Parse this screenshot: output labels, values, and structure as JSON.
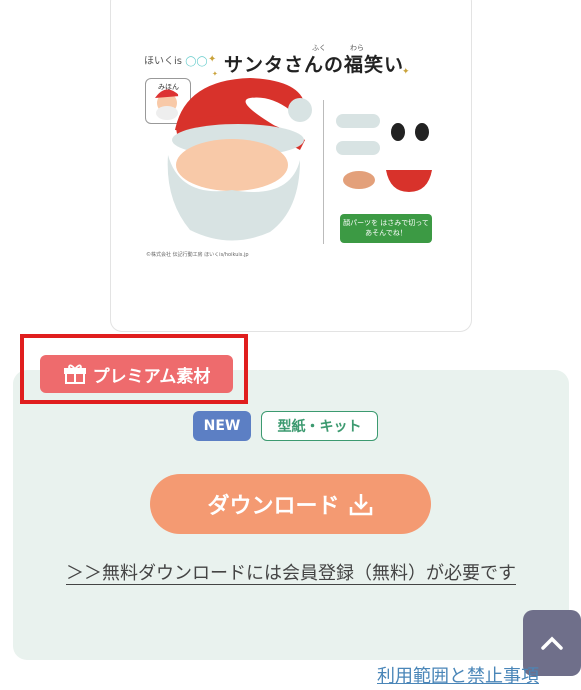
{
  "preview": {
    "brand": "ほいくis",
    "title": "サンタさんの福笑い",
    "ruby_fuku": "ふく",
    "ruby_warai": "わら",
    "sample_label": "みほん",
    "hint_text": "顔パーツを はさみで切って あそんでね！",
    "copyright": "©株式会社 伝記行動工房 ほいくis/hoikuis.jp"
  },
  "premium_badge": {
    "label": "プレミアム素材",
    "icon": "gift-icon"
  },
  "tags": [
    {
      "label": "NEW"
    },
    {
      "label": "型紙・キット"
    }
  ],
  "download": {
    "label": "ダウンロード",
    "icon": "download-icon"
  },
  "free_download_note": "＞＞無料ダウンロードには会員登録（無料）が必要です",
  "scroll_top": {
    "icon": "chevron-up-icon"
  },
  "terms_link": "利用範囲と禁止事項",
  "colors": {
    "premium": "#ee6b6d",
    "new_badge": "#5c7fc4",
    "kit_badge": "#3c9a70",
    "download_button": "#f49a72",
    "panel_bg": "#e9f2ee",
    "highlight_border": "#e01e1e"
  }
}
